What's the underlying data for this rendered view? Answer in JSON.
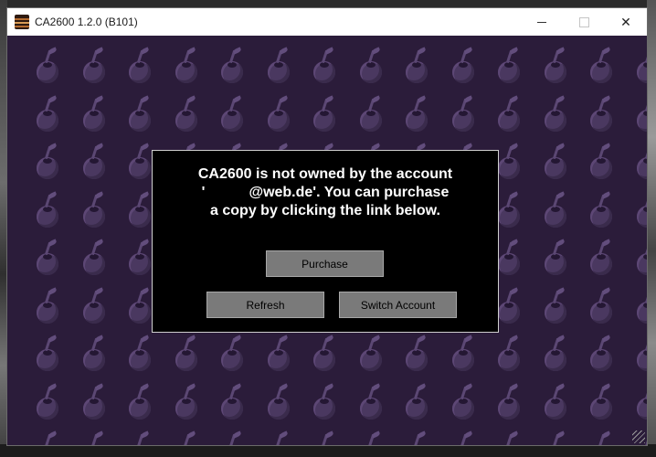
{
  "window": {
    "title": "CA2600 1.2.0 (B101)",
    "close_symbol": "✕",
    "app_icon": "ca2600-app-icon"
  },
  "dialog": {
    "message_line1": "CA2600 is not owned by the account",
    "message_line2": "'   @web.de'.  You can purchase",
    "message_line3": "a copy by clicking the link below.",
    "purchase_label": "Purchase",
    "refresh_label": "Refresh",
    "switch_account_label": "Switch Account"
  },
  "colors": {
    "background": "#2b1c3a",
    "pattern": "#4a3860",
    "dialog_bg": "#000000",
    "button_bg": "#7a7a7a"
  }
}
